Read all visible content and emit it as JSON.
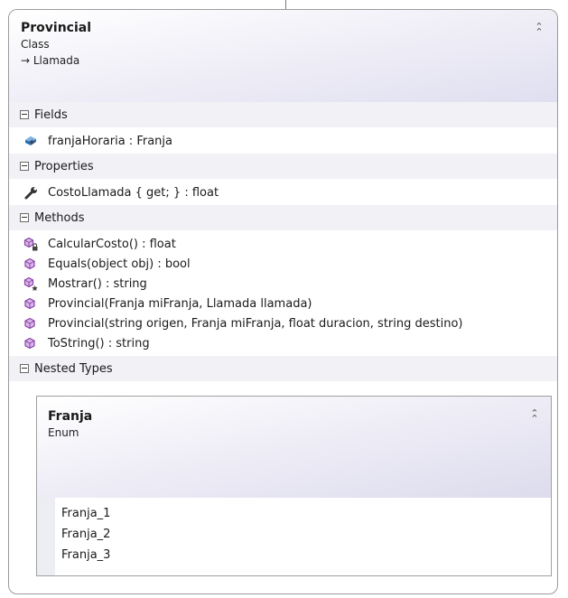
{
  "class": {
    "name": "Provincial",
    "kind": "Class",
    "base": "→ Llamada",
    "collapse_icon": "double-chevron-up-icon"
  },
  "sections": {
    "fields": {
      "label": "Fields"
    },
    "properties": {
      "label": "Properties"
    },
    "methods": {
      "label": "Methods"
    },
    "nested_types": {
      "label": "Nested Types"
    }
  },
  "fields": [
    {
      "text": "franjaHoraria : Franja",
      "icon": "protected-field-icon"
    }
  ],
  "properties": [
    {
      "text": "CostoLlamada { get; } : float",
      "icon": "property-wrench-icon"
    }
  ],
  "methods": [
    {
      "text": "CalcularCosto() : float",
      "icon": "private-method-icon"
    },
    {
      "text": "Equals(object obj) : bool",
      "icon": "public-method-icon"
    },
    {
      "text": "Mostrar() : string",
      "icon": "protected-method-icon"
    },
    {
      "text": "Provincial(Franja miFranja, Llamada llamada)",
      "icon": "public-method-icon"
    },
    {
      "text": "Provincial(string origen, Franja miFranja, float duracion, string destino)",
      "icon": "public-method-icon"
    },
    {
      "text": "ToString() : string",
      "icon": "public-method-icon"
    }
  ],
  "nested": {
    "name": "Franja",
    "kind": "Enum",
    "values": [
      "Franja_1",
      "Franja_2",
      "Franja_3"
    ]
  },
  "colors": {
    "method_icon": "#8a3fa8",
    "field_icon": "#2a6fb5",
    "border": "#9b9b9b"
  }
}
